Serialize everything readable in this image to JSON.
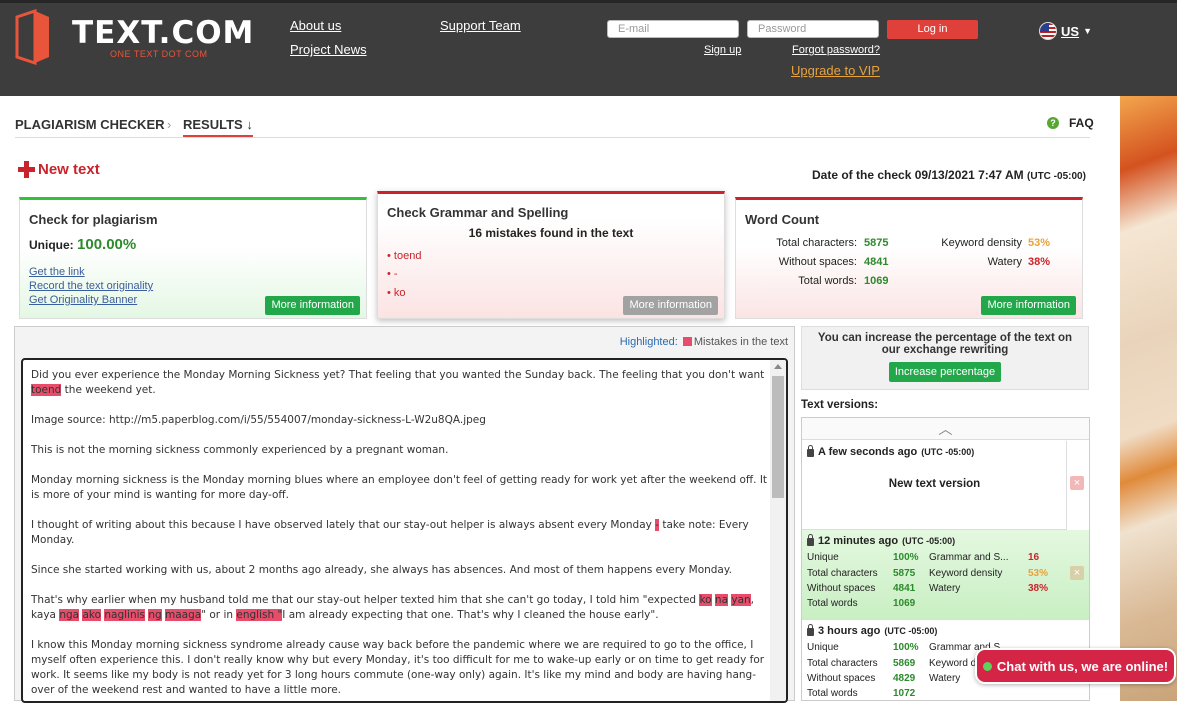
{
  "header": {
    "logo_text": "TEXT.COM",
    "logo_tagline": "ONE TEXT DOT COM",
    "nav": {
      "about": "About us",
      "news": "Project News",
      "support": "Support Team"
    },
    "email_placeholder": "E-mail",
    "password_placeholder": "Password",
    "login_label": "Log in",
    "signup_label": "Sign up",
    "forgot_label": "Forgot password?",
    "vip_label": "Upgrade to VIP",
    "language": "US"
  },
  "breadcrumb": {
    "checker": "PLAGIARISM CHECKER",
    "results": "RESULTS ↓"
  },
  "faq_label": "FAQ",
  "new_text_label": "New text",
  "check_date": {
    "label": "Date of the check 09/13/2021 7:47 AM",
    "tz": "(UTC -05:00)"
  },
  "plagiarism_card": {
    "title": "Check for plagiarism",
    "unique_label": "Unique:",
    "unique_value": "100.00%",
    "links": [
      "Get the link",
      "Record the text originality",
      "Get Originality Banner"
    ],
    "more": "More information"
  },
  "grammar_card": {
    "title": "Check Grammar and Spelling",
    "summary": "16 mistakes found in the text",
    "mistakes": [
      "• toend",
      "• -",
      "• ko"
    ],
    "more": "More information"
  },
  "count_card": {
    "title": "Word Count",
    "total_chars_label": "Total characters:",
    "total_chars": "5875",
    "without_spaces_label": "Without spaces:",
    "without_spaces": "4841",
    "total_words_label": "Total words:",
    "total_words": "1069",
    "keyword_label": "Keyword density",
    "keyword": "53%",
    "watery_label": "Watery",
    "watery": "38%",
    "more": "More information"
  },
  "highlight": {
    "label": "Highlighted:",
    "legend": "Mistakes in the text"
  },
  "text": {
    "p1a": "Did you ever experience the Monday Morning Sickness yet? That feeling that you wanted the Sunday back. The feeling that you don't want ",
    "p1m": "toend",
    "p1b": " the weekend yet.",
    "p2": "Image source: http://m5.paperblog.com/i/55/554007/monday-sickness-L-W2u8QA.jpeg",
    "p3": "This is not the morning sickness commonly experienced by a pregnant woman.",
    "p4": "Monday morning sickness is the Monday morning blues where an employee don't feel of getting ready for work yet after the weekend off. It is more of your mind is wanting for more day-off.",
    "p5a": "I thought of writing about this because I have observed lately that our stay-out helper is always absent every Monday ",
    "p5m": "-",
    "p5b": " take note: Every Monday.",
    "p6": "Since she started working with us, about 2 months ago already, she always has absences. And most of them happens every Monday.",
    "p7a": "That's why earlier when my husband told me that our stay-out helper texted him that she can't go today, I told him \"expected ",
    "p7m1": "ko",
    "p7m2": "na",
    "p7m3": "yan",
    "p7b": ", kaya ",
    "p7m4": "nga",
    "p7m5": "ako",
    "p7m6": "naglinis",
    "p7m7": "ng",
    "p7m8": "maaga",
    "p7c": "\" or in ",
    "p7m9": "english",
    "p7m10": " \"",
    "p7d": "I am already expecting that one. That's why I cleaned the house early\".",
    "p8": "I know this Monday morning sickness syndrome already cause way back before the pandemic where we are required to go to the office, I myself often experience this. I don't really know why but every Monday, it's too difficult for me to wake-up early or on time to get ready for work. It seems like my body is not ready yet for 3 long hours commute (one-way only) again. It's like my mind and body are having hang-over of the weekend rest and wanted to have a little more."
  },
  "increase": {
    "text": "You can increase the percentage of the text on our exchange rewriting",
    "button": "Increase percentage"
  },
  "versions_label": "Text versions:",
  "versions": [
    {
      "time": "A few seconds ago",
      "tz": "(UTC -05:00)",
      "body": "New text version"
    },
    {
      "time": "12 minutes ago",
      "tz": "(UTC -05:00)",
      "unique_label": "Unique",
      "unique": "100%",
      "grammar_label": "Grammar and S...",
      "grammar": "16",
      "chars_label": "Total characters",
      "chars": "5875",
      "keyword_label": "Keyword density",
      "keyword": "53%",
      "nospace_label": "Without spaces",
      "nospace": "4841",
      "watery_label": "Watery",
      "watery": "38%",
      "words_label": "Total words",
      "words": "1069"
    },
    {
      "time": "3 hours ago",
      "tz": "(UTC -05:00)",
      "unique_label": "Unique",
      "unique": "100%",
      "grammar_label": "Grammar and S...",
      "grammar": "",
      "chars_label": "Total characters",
      "chars": "5869",
      "keyword_label": "Keyword d",
      "keyword": "",
      "nospace_label": "Without spaces",
      "nospace": "4829",
      "watery_label": "Watery",
      "watery": "",
      "words_label": "Total words",
      "words": "1072"
    }
  ],
  "chat_label": "Chat with us, we are online!"
}
